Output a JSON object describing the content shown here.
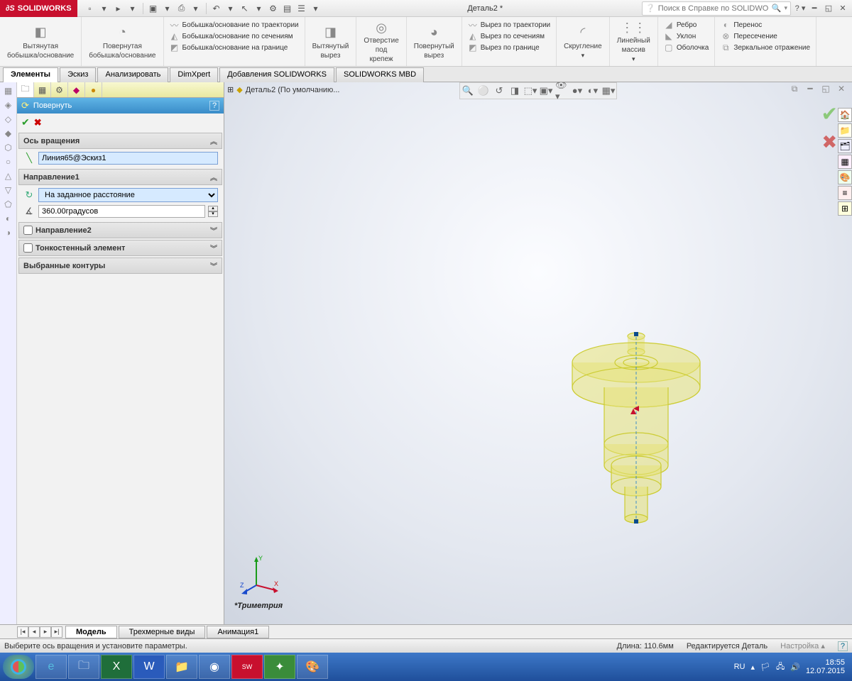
{
  "app": {
    "name": "SOLIDWORKS",
    "doc_title": "Деталь2 *"
  },
  "search": {
    "placeholder": "Поиск в Справке по SOLIDWORKS"
  },
  "ribbon": {
    "extrude": {
      "l1": "Вытянутая",
      "l2": "бобышка/основание"
    },
    "revolve": {
      "l1": "Повернутая",
      "l2": "бобышка/основание"
    },
    "boss_col": [
      "Бобышка/основание по траектории",
      "Бобышка/основание по сечениям",
      "Бобышка/основание на границе"
    ],
    "cut_extrude": {
      "l1": "Вытянутый",
      "l2": "вырез"
    },
    "hole": {
      "l1": "Отверстие",
      "l2": "под",
      "l3": "крепеж"
    },
    "cut_revolve": {
      "l1": "Повернутый",
      "l2": "вырез"
    },
    "cut_col": [
      "Вырез по траектории",
      "Вырез по сечениям",
      "Вырез по границе"
    ],
    "fillet": "Скругление",
    "pattern": {
      "l1": "Линейный",
      "l2": "массив"
    },
    "feat_col1": [
      "Ребро",
      "Уклон",
      "Оболочка"
    ],
    "feat_col2": [
      "Перенос",
      "Пересечение",
      "Зеркальное отражение"
    ]
  },
  "tabs": [
    "Элементы",
    "Эскиз",
    "Анализировать",
    "DimXpert",
    "Добавления SOLIDWORKS",
    "SOLIDWORKS MBD"
  ],
  "breadcrumb": "Деталь2  (По умолчанию...",
  "panel": {
    "title": "Повернуть",
    "sec_axis": "Ось вращения",
    "axis_value": "Линия65@Эскиз1",
    "sec_dir1": "Направление1",
    "dir_type": "На заданное расстояние",
    "angle": "360.00градусов",
    "sec_dir2": "Направление2",
    "sec_thin": "Тонкостенный элемент",
    "sec_contours": "Выбранные контуры"
  },
  "viewport": {
    "label": "*Триметрия"
  },
  "bottom_tabs": [
    "Модель",
    "Трехмерные виды",
    "Анимация1"
  ],
  "status": {
    "hint": "Выберите ось вращения и установите параметры.",
    "length": "Длина: 110.6мм",
    "mode": "Редактируется Деталь",
    "custom": "Настройка"
  },
  "tray": {
    "lang": "RU",
    "time": "18:55",
    "date": "12.07.2015"
  }
}
